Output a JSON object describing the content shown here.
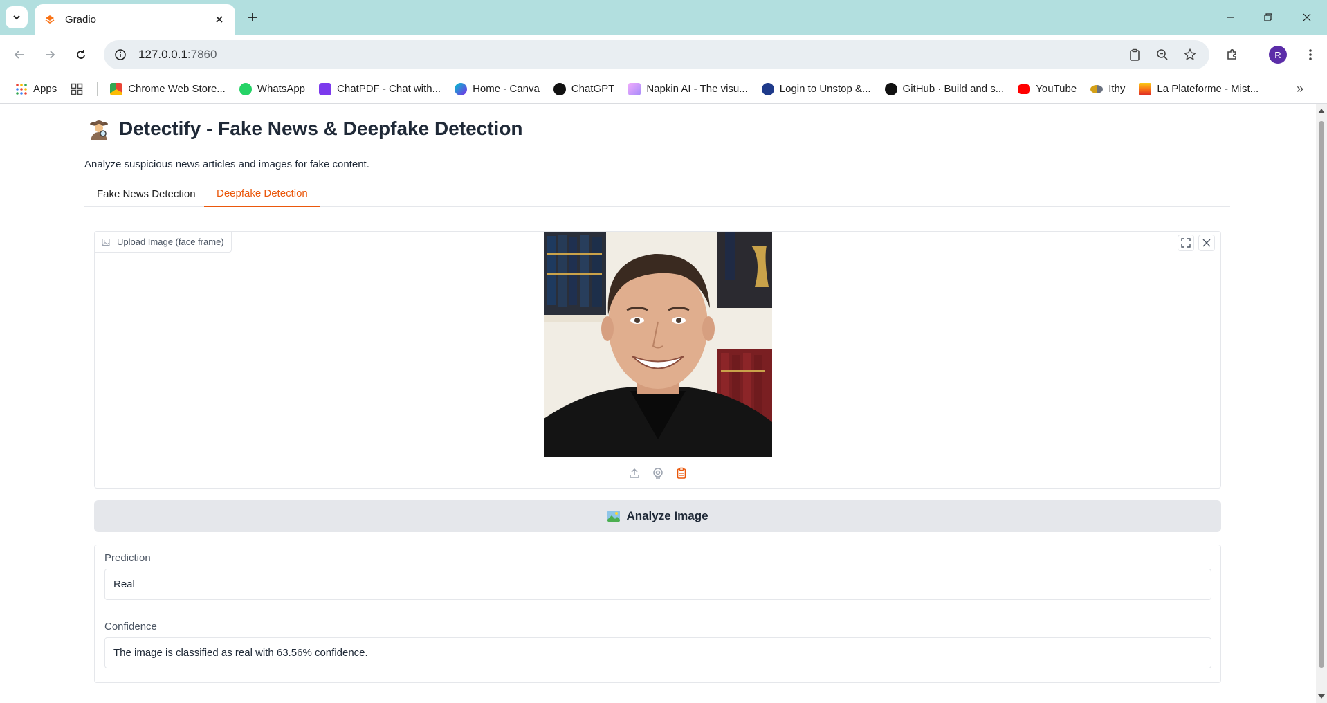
{
  "browser": {
    "tab_title": "Gradio",
    "url_host": "127.0.0.1",
    "url_port": ":7860",
    "avatar_letter": "R",
    "bookmarks": [
      {
        "label": "Apps",
        "color": "#4285f4"
      },
      {
        "label": "Chrome Web Store...",
        "color": "#34a853"
      },
      {
        "label": "WhatsApp",
        "color": "#25d366"
      },
      {
        "label": "ChatPDF - Chat with...",
        "color": "#7c3aed"
      },
      {
        "label": "Home - Canva",
        "color": "#00c4cc"
      },
      {
        "label": "ChatGPT",
        "color": "#111111"
      },
      {
        "label": "Napkin AI - The visu...",
        "color": "#c084fc"
      },
      {
        "label": "Login to Unstop &...",
        "color": "#1e3a8a"
      },
      {
        "label": "GitHub · Build and s...",
        "color": "#111111"
      },
      {
        "label": "YouTube",
        "color": "#ff0000"
      },
      {
        "label": "Ithy",
        "color": "#d4a017"
      },
      {
        "label": "La Plateforme - Mist...",
        "color": "#f97316"
      }
    ]
  },
  "app": {
    "title": "Detectify - Fake News & Deepfake Detection",
    "description": "Analyze suspicious news articles and images for fake content.",
    "tabs": [
      {
        "label": "Fake News Detection",
        "active": false
      },
      {
        "label": "Deepfake Detection",
        "active": true
      }
    ],
    "image_input": {
      "label": "Upload Image (face frame)"
    },
    "analyze_button": "Analyze Image",
    "outputs": {
      "prediction_label": "Prediction",
      "prediction_value": "Real",
      "confidence_label": "Confidence",
      "confidence_value": "The image is classified as real with 63.56% confidence."
    }
  },
  "colors": {
    "accent": "#ea580c",
    "tabstrip": "#b2dfdf"
  }
}
